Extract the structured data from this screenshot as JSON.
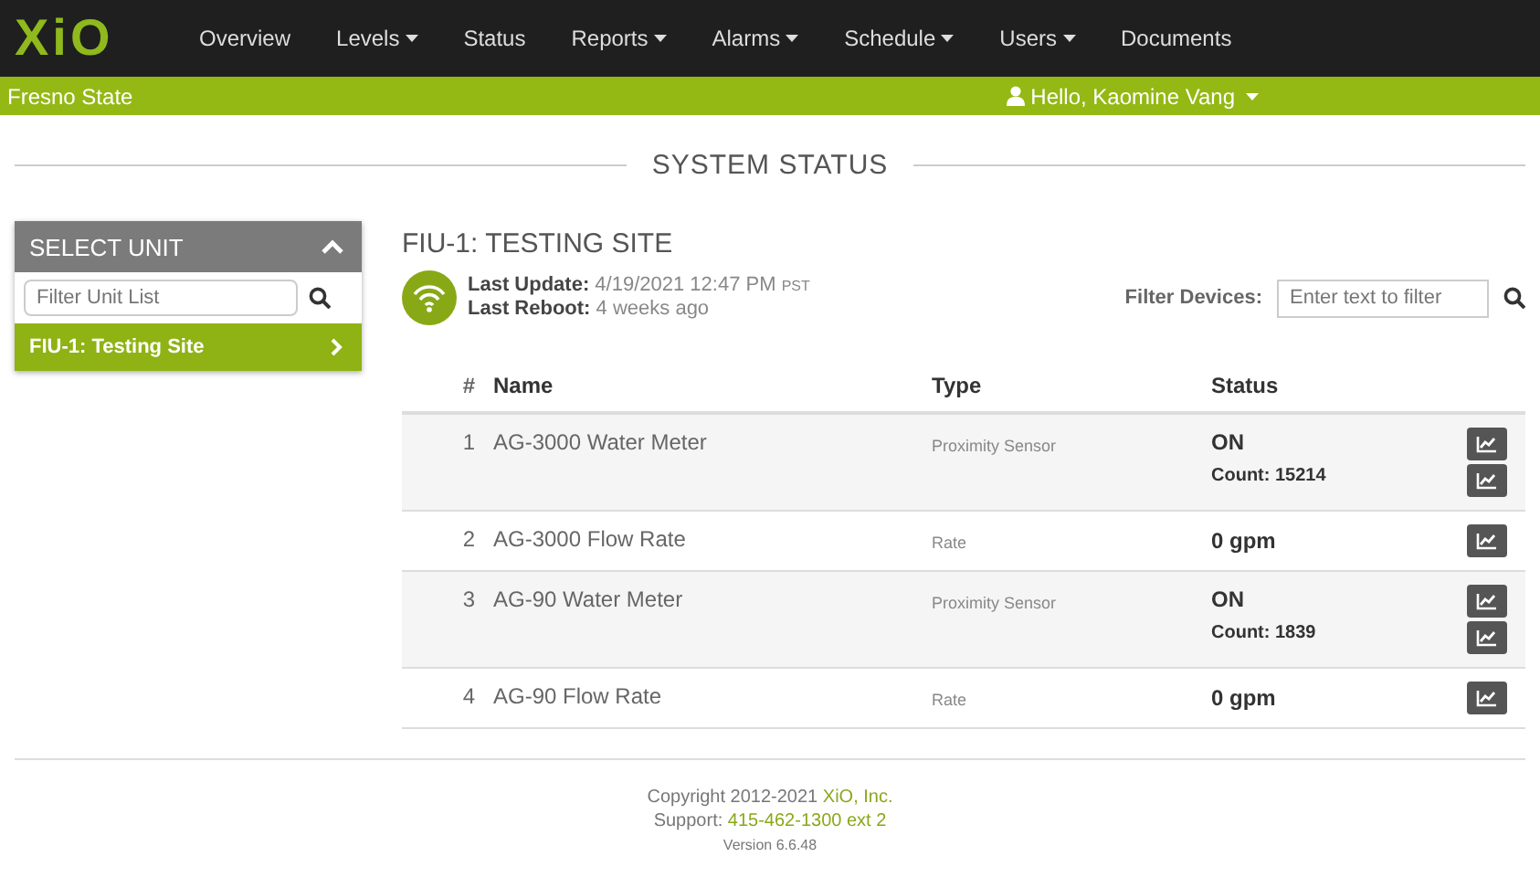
{
  "navbar": {
    "logo": "XiO",
    "items": [
      {
        "label": "Overview",
        "dropdown": false
      },
      {
        "label": "Levels",
        "dropdown": true
      },
      {
        "label": "Status",
        "dropdown": false
      },
      {
        "label": "Reports",
        "dropdown": true
      },
      {
        "label": "Alarms",
        "dropdown": true
      },
      {
        "label": "Schedule",
        "dropdown": true
      },
      {
        "label": "Users",
        "dropdown": true
      },
      {
        "label": "Documents",
        "dropdown": false
      }
    ]
  },
  "subbar": {
    "organization": "Fresno State",
    "user_greeting": "Hello, Kaomine Vang"
  },
  "page_title": "SYSTEM STATUS",
  "sidebar": {
    "title": "SELECT UNIT",
    "expanded": true,
    "filter": {
      "placeholder": "Filter Unit List"
    },
    "items": [
      {
        "label": "FIU-1: Testing Site",
        "selected": true
      }
    ]
  },
  "unit": {
    "title": "FIU-1: TESTING SITE",
    "last_update_label": "Last Update:",
    "last_update": "4/19/2021 12:47 PM",
    "timezone": "PST",
    "last_reboot_label": "Last Reboot:",
    "last_reboot": "4 weeks ago",
    "filter_label": "Filter Devices:",
    "filter": {
      "placeholder": "Enter text to filter"
    }
  },
  "table": {
    "columns": [
      "#",
      "Name",
      "Type",
      "Status"
    ],
    "rows": [
      {
        "kind": "counter",
        "number": "1",
        "name": "AG-3000 Water Meter",
        "type": "Proximity Sensor",
        "status": "ON",
        "count": "Count: 15214"
      },
      {
        "kind": "rate",
        "number": "2",
        "name": "AG-3000 Flow Rate",
        "type": "Rate",
        "status": "0 gpm"
      },
      {
        "kind": "counter",
        "number": "3",
        "name": "AG-90 Water Meter",
        "type": "Proximity Sensor",
        "status": "ON",
        "count": "Count: 1839"
      },
      {
        "kind": "rate",
        "number": "4",
        "name": "AG-90 Flow Rate",
        "type": "Rate",
        "status": "0 gpm"
      }
    ]
  },
  "footer": {
    "copyright": "Copyright 2012-2021",
    "company": "XiO, Inc.",
    "support_label": "Support:",
    "support_phone": "415-462-1300 ext 2",
    "version": "Version 6.6.48"
  }
}
